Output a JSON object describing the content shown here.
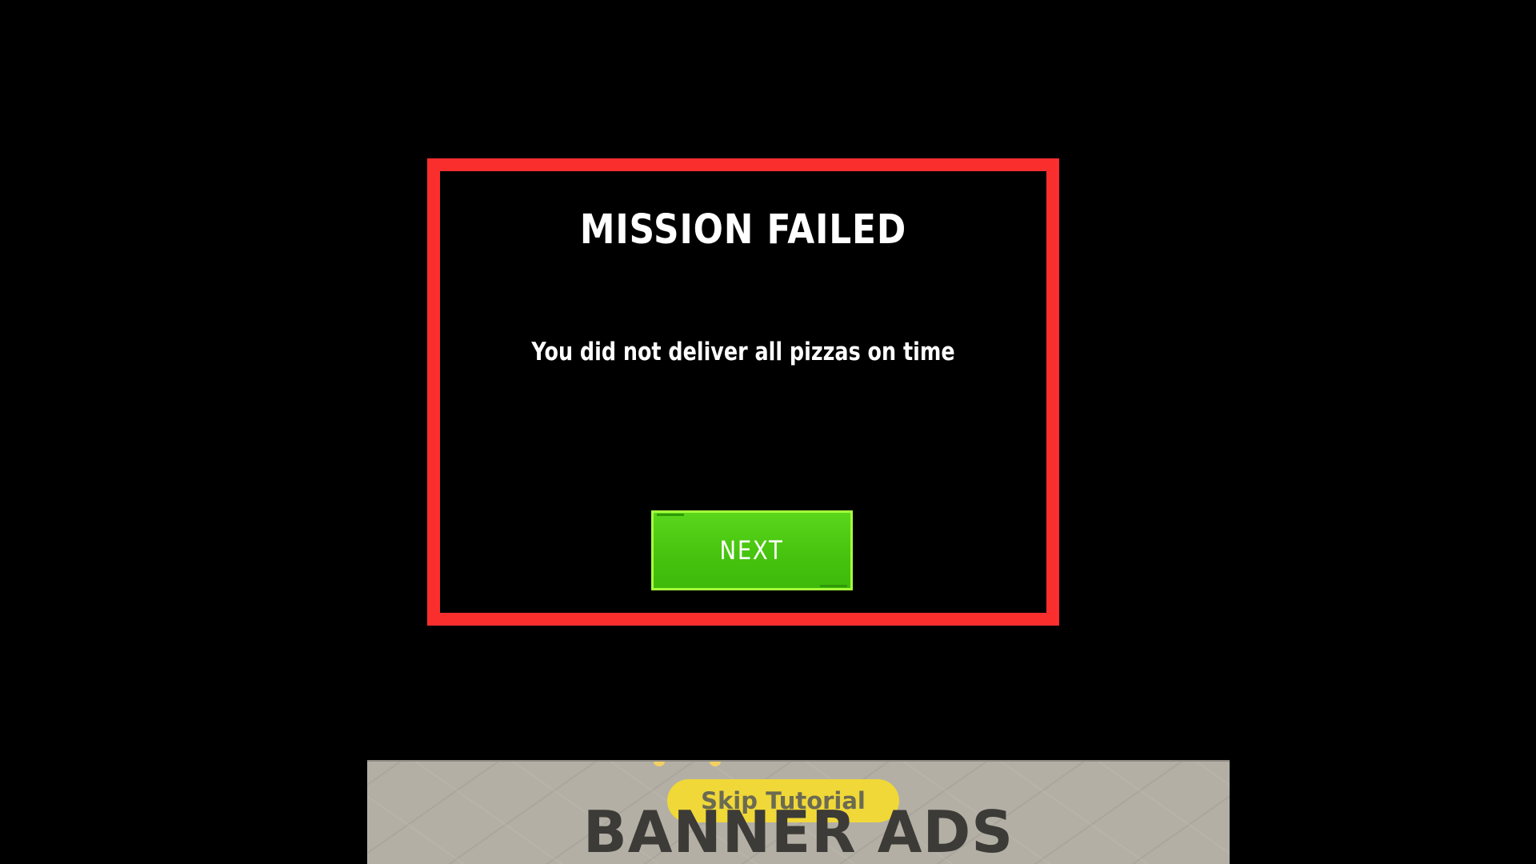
{
  "modal": {
    "title": "MISSION FAILED",
    "message": "You did not deliver all pizzas on time",
    "next_label": "NEXT"
  },
  "banner": {
    "skip_label": "Skip Tutorial",
    "text": "BANNER ADS"
  },
  "colors": {
    "background": "#000000",
    "modal_border": "#fb2e2e",
    "button_green": "#47c40f",
    "button_border": "#a6ff3c",
    "banner_background": "#b3afa5",
    "skip_pill": "#f0d838"
  }
}
